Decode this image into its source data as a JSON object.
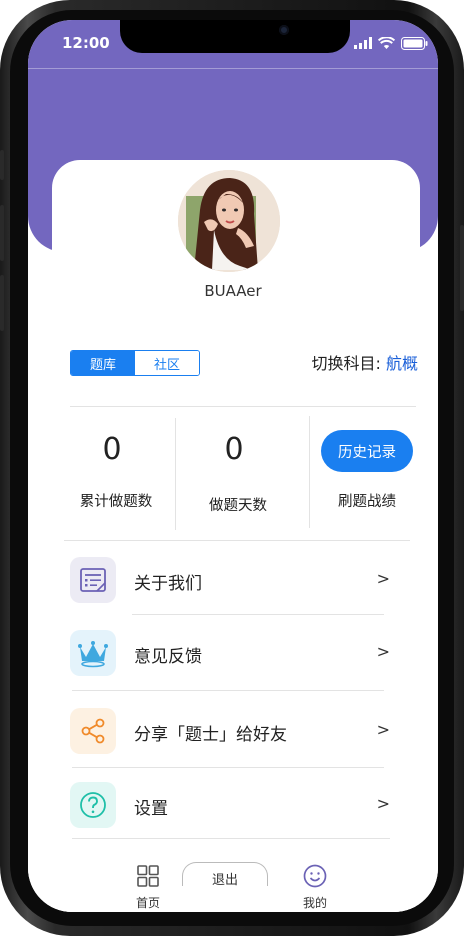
{
  "status_bar": {
    "time": "12:00"
  },
  "profile": {
    "username": "BUAAer"
  },
  "tabs": {
    "active": "题库",
    "inactive": "社区"
  },
  "subject": {
    "label": "切换科目:",
    "value": "航概"
  },
  "stats": [
    {
      "value": "0",
      "label": "累计做题数"
    },
    {
      "value": "0",
      "label": "做题天数"
    }
  ],
  "history": {
    "button_label": "历史记录",
    "caption": "刷题战绩"
  },
  "menu": [
    {
      "label": "关于我们",
      "icon": "document-list-icon",
      "arrow": ">"
    },
    {
      "label": "意见反馈",
      "icon": "crown-icon",
      "arrow": ">"
    },
    {
      "label": "分享「题士」给好友",
      "icon": "share-icon",
      "arrow": ">"
    },
    {
      "label": "设置",
      "icon": "help-circle-icon",
      "arrow": ">"
    }
  ],
  "logout": {
    "label": "退出"
  },
  "tabbar": [
    {
      "label": "首页",
      "icon": "grid-icon"
    },
    {
      "label": "我的",
      "icon": "smile-icon"
    }
  ],
  "colors": {
    "header": "#7367bf",
    "primary": "#1a7ff0",
    "subject_value": "#1a5fd8"
  }
}
